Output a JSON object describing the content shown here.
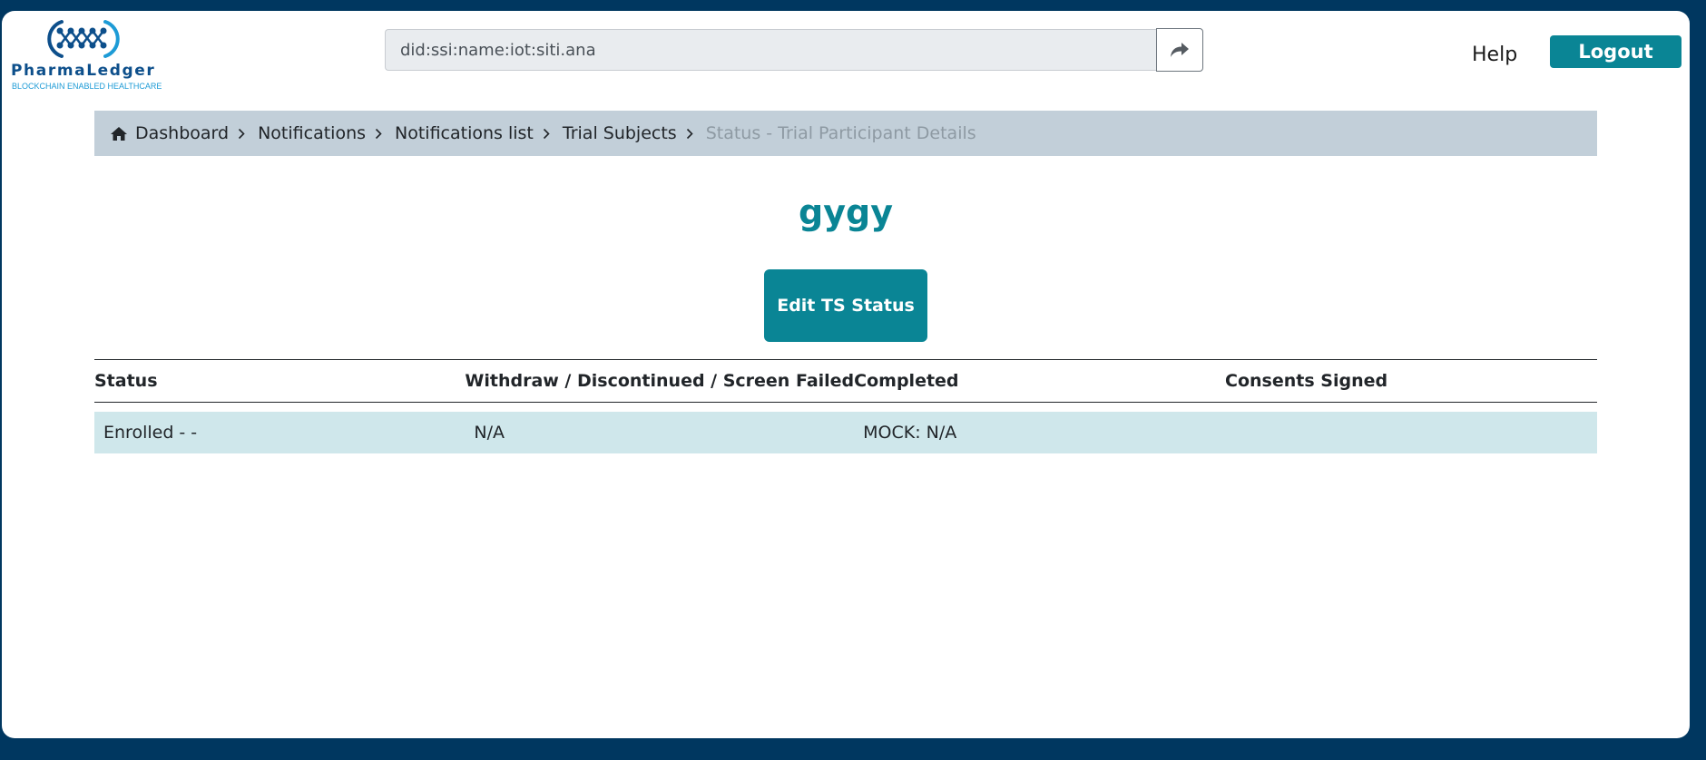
{
  "header": {
    "logo": {
      "name": "PharmaLedger",
      "tagline": "BLOCKCHAIN ENABLED HEALTHCARE"
    },
    "did_input_value": "did:ssi:name:iot:siti.ana",
    "share_icon": "share-icon",
    "help_label": "Help",
    "logout_label": "Logout"
  },
  "breadcrumb": {
    "home_icon": "home-icon",
    "items": [
      "Dashboard",
      "Notifications",
      "Notifications list",
      "Trial Subjects"
    ],
    "active": "Status - Trial Participant Details"
  },
  "page": {
    "title": "gygy",
    "edit_button_label": "Edit TS Status"
  },
  "table": {
    "columns": [
      "Status",
      "Withdraw / Discontinued / Screen Failed",
      "Completed",
      "Consents Signed"
    ],
    "rows": [
      [
        "Enrolled - -",
        "N/A",
        "MOCK: N/A",
        ""
      ]
    ]
  },
  "colors": {
    "page_background": "#003760",
    "accent": "#0a8595",
    "breadcrumb_background": "#c2cfd9",
    "row_background": "#cfe7eb"
  }
}
